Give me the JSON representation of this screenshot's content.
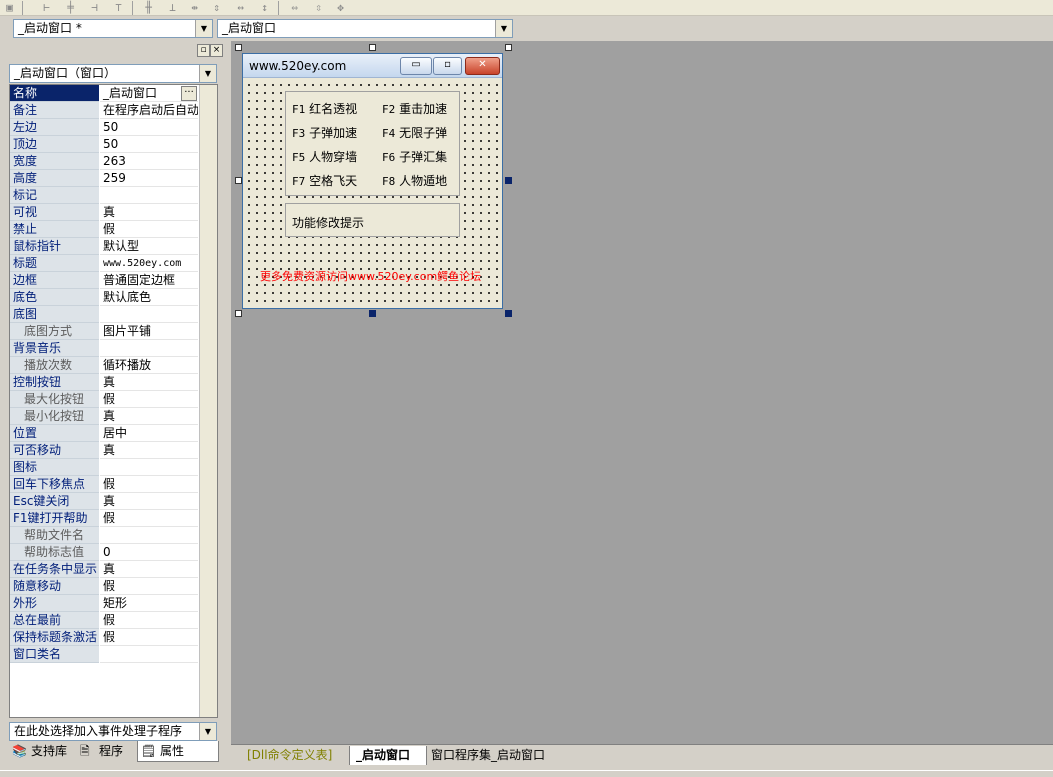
{
  "toolbar": {
    "icons": [
      "window-icon",
      "align-left-icon",
      "align-center-icon",
      "align-right-icon",
      "align-top-icon",
      "align-middle-icon",
      "align-bottom-icon",
      "distribute-h-icon",
      "distribute-v-icon",
      "size-width-icon",
      "size-height-icon",
      "size-both-icon",
      "center-h-icon",
      "center-v-icon",
      "center-both-icon"
    ]
  },
  "combos": {
    "object_select": "_启动窗口 *",
    "event_select": "_启动窗口"
  },
  "properties": {
    "object_combo": "_启动窗口（窗口）",
    "rows": [
      {
        "name": "名称",
        "value": "_启动窗口",
        "sub": false
      },
      {
        "name": "备注",
        "value": "在程序启动后自动",
        "sub": false
      },
      {
        "name": "左边",
        "value": "50",
        "sub": false
      },
      {
        "name": "顶边",
        "value": "50",
        "sub": false
      },
      {
        "name": "宽度",
        "value": "263",
        "sub": false
      },
      {
        "name": "高度",
        "value": "259",
        "sub": false
      },
      {
        "name": "标记",
        "value": "",
        "sub": false
      },
      {
        "name": "可视",
        "value": "真",
        "sub": false
      },
      {
        "name": "禁止",
        "value": "假",
        "sub": false
      },
      {
        "name": "鼠标指针",
        "value": "默认型",
        "sub": false
      },
      {
        "name": "标题",
        "value": "www.520ey.com",
        "sub": false
      },
      {
        "name": "边框",
        "value": "普通固定边框",
        "sub": false
      },
      {
        "name": "底色",
        "value": "默认底色",
        "sub": false
      },
      {
        "name": "底图",
        "value": "",
        "sub": false
      },
      {
        "name": "底图方式",
        "value": "图片平铺",
        "sub": true
      },
      {
        "name": "背景音乐",
        "value": "",
        "sub": false
      },
      {
        "name": "播放次数",
        "value": "循环播放",
        "sub": true
      },
      {
        "name": "控制按钮",
        "value": "真",
        "sub": false
      },
      {
        "name": "最大化按钮",
        "value": "假",
        "sub": true
      },
      {
        "name": "最小化按钮",
        "value": "真",
        "sub": true
      },
      {
        "name": "位置",
        "value": "居中",
        "sub": false
      },
      {
        "name": "可否移动",
        "value": "真",
        "sub": false
      },
      {
        "name": "图标",
        "value": "",
        "sub": false
      },
      {
        "name": "回车下移焦点",
        "value": "假",
        "sub": false
      },
      {
        "name": "Esc键关闭",
        "value": "真",
        "sub": false
      },
      {
        "name": "F1键打开帮助",
        "value": "假",
        "sub": false
      },
      {
        "name": "帮助文件名",
        "value": "",
        "sub": true
      },
      {
        "name": "帮助标志值",
        "value": "0",
        "sub": true
      },
      {
        "name": "在任务条中显示",
        "value": "真",
        "sub": false
      },
      {
        "name": "随意移动",
        "value": "假",
        "sub": false
      },
      {
        "name": "外形",
        "value": "矩形",
        "sub": false
      },
      {
        "name": "总在最前",
        "value": "假",
        "sub": false
      },
      {
        "name": "保持标题条激活",
        "value": "假",
        "sub": false
      },
      {
        "name": "窗口类名",
        "value": "",
        "sub": false
      }
    ],
    "event_combo": "在此处选择加入事件处理子程序"
  },
  "bottom_tabs": [
    {
      "label": "支持库",
      "icon": "library-icon"
    },
    {
      "label": "程序",
      "icon": "program-icon"
    },
    {
      "label": "属性",
      "icon": "properties-icon"
    }
  ],
  "form": {
    "title": "www.520ey.com",
    "functions": [
      {
        "key": "F1",
        "label": "红名透视"
      },
      {
        "key": "F2",
        "label": "重击加速"
      },
      {
        "key": "F3",
        "label": "子弹加速"
      },
      {
        "key": "F4",
        "label": "无限子弹"
      },
      {
        "key": "F5",
        "label": "人物穿墙"
      },
      {
        "key": "F6",
        "label": "子弹汇集"
      },
      {
        "key": "F7",
        "label": "空格飞天"
      },
      {
        "key": "F8",
        "label": "人物遁地"
      }
    ],
    "hint": "功能修改提示",
    "footer": "更多免费资源访问www.520ey.com鳄鱼论坛",
    "footer_color": "#ff0000"
  },
  "doc_tabs": [
    {
      "label": "[Dll命令定义表]",
      "active": false
    },
    {
      "label": "_启动窗口",
      "active": true
    },
    {
      "label": "窗口程序集_启动窗口",
      "active": false
    }
  ],
  "colors": {
    "selected_row": "#0a246a",
    "property_name_text": "#001e79",
    "design_background": "#a0a0a0"
  }
}
